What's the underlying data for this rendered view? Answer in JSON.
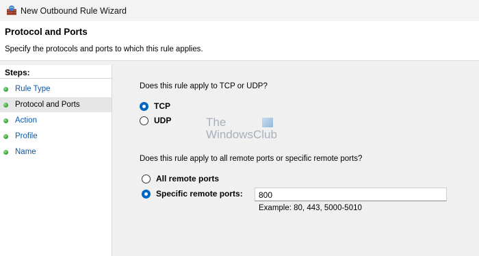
{
  "window": {
    "title": "New Outbound Rule Wizard"
  },
  "header": {
    "title": "Protocol and Ports",
    "subtitle": "Specify the protocols and ports to which this rule applies."
  },
  "sidebar": {
    "heading": "Steps:",
    "items": [
      {
        "label": "Rule Type",
        "active": false
      },
      {
        "label": "Protocol and Ports",
        "active": true
      },
      {
        "label": "Action",
        "active": false
      },
      {
        "label": "Profile",
        "active": false
      },
      {
        "label": "Name",
        "active": false
      }
    ]
  },
  "protocol": {
    "question": "Does this rule apply to TCP or UDP?",
    "options": [
      {
        "label": "TCP",
        "selected": true
      },
      {
        "label": "UDP",
        "selected": false
      }
    ]
  },
  "ports": {
    "question": "Does this rule apply to all remote ports or specific remote ports?",
    "options": [
      {
        "label": "All remote ports",
        "selected": false
      },
      {
        "label": "Specific remote ports:",
        "selected": true
      }
    ],
    "input_value": "800",
    "example": "Example: 80, 443, 5000-5010"
  },
  "watermark": {
    "line1": "The",
    "line2": "WindowsClub"
  },
  "colors": {
    "accent": "#0067c0",
    "link": "#0b58a8",
    "step_dot": "#2f9e2f"
  }
}
